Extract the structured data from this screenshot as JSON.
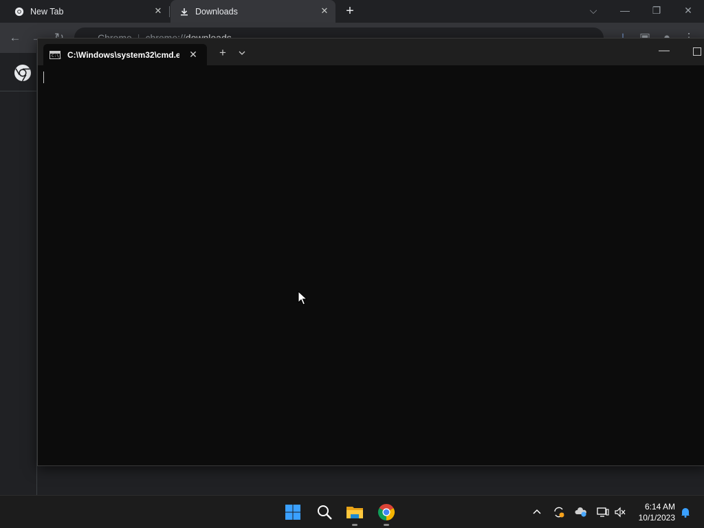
{
  "chrome": {
    "tabs": [
      {
        "label": "New Tab",
        "icon": "chrome-icon"
      },
      {
        "label": "Downloads",
        "icon": "download-icon"
      }
    ],
    "omnibox": {
      "site_label": "Chrome",
      "url_prefix": "chrome://",
      "url_path": "downloads"
    }
  },
  "terminal": {
    "tab_title": "C:\\Windows\\system32\\cmd.e",
    "icon_text": "C:\\_"
  },
  "taskbar": {
    "apps": [
      "windows-start-icon",
      "search-icon",
      "file-explorer-icon",
      "chrome-icon"
    ],
    "clock_time": "6:14 AM",
    "clock_date": "10/1/2023"
  },
  "colors": {
    "chrome_bg": "#202124",
    "chrome_toolbar": "#35363a",
    "terminal_bg": "#0c0c0c",
    "terminal_titlebar": "#1f1f1f",
    "taskbar_bg": "#1c1c1c",
    "accent_blue": "#0078d4"
  }
}
